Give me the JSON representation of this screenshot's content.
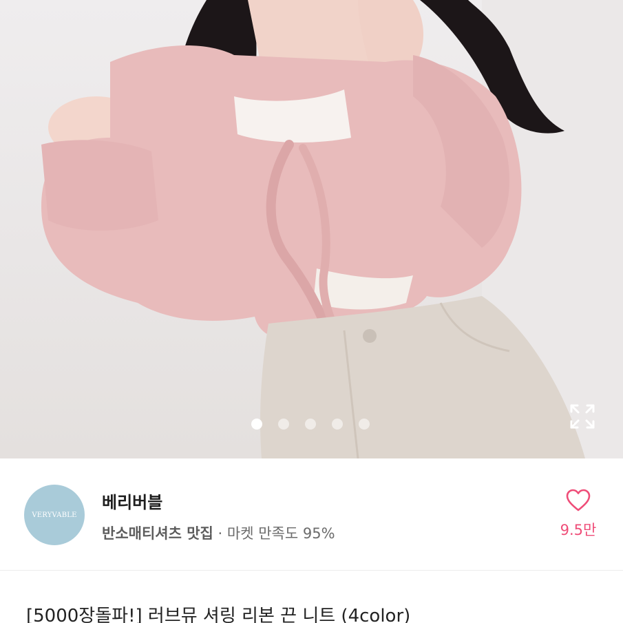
{
  "gallery": {
    "slide_count": 5,
    "active_index": 0,
    "expand_icon": "expand-icon"
  },
  "seller": {
    "avatar_text": "VERYVABLE",
    "name": "베리버블",
    "tagline": "반소매티셔츠 맛집",
    "separator": " · ",
    "satisfaction": "마켓 만족도 95%",
    "like_icon": "heart-outline-icon",
    "like_count": "9.5만"
  },
  "product": {
    "title": "[5000장돌파!] 러브뮤 셔링 리본 끈 니트 (4color)"
  },
  "colors": {
    "accent": "#ef4d78",
    "avatar_bg": "#a9cbd9",
    "sweater": "#e9bcbc",
    "jeans": "#ddd5cd"
  }
}
